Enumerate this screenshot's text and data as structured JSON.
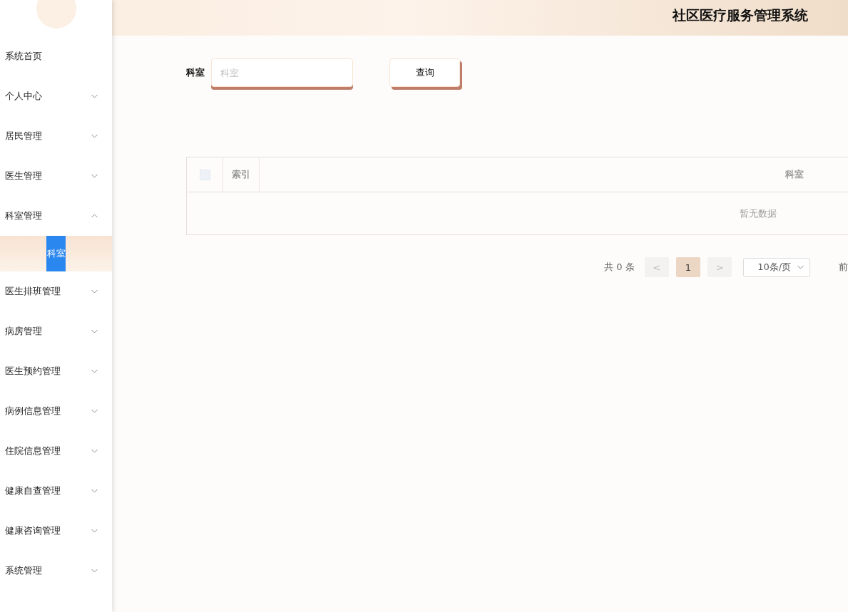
{
  "header": {
    "title": "社区医疗服务管理系统"
  },
  "sidebar": {
    "items": [
      {
        "label": "系统首页",
        "kind": "link"
      },
      {
        "label": "个人中心",
        "kind": "group",
        "expanded": false
      },
      {
        "label": "居民管理",
        "kind": "group",
        "expanded": false
      },
      {
        "label": "医生管理",
        "kind": "group",
        "expanded": false
      },
      {
        "label": "科室管理",
        "kind": "group",
        "expanded": true,
        "children": [
          {
            "label": "科室",
            "selected": true
          }
        ]
      },
      {
        "label": "医生排班管理",
        "kind": "group",
        "expanded": false
      },
      {
        "label": "病房管理",
        "kind": "group",
        "expanded": false
      },
      {
        "label": "医生预约管理",
        "kind": "group",
        "expanded": false
      },
      {
        "label": "病例信息管理",
        "kind": "group",
        "expanded": false
      },
      {
        "label": "住院信息管理",
        "kind": "group",
        "expanded": false
      },
      {
        "label": "健康自查管理",
        "kind": "group",
        "expanded": false
      },
      {
        "label": "健康咨询管理",
        "kind": "group",
        "expanded": false
      },
      {
        "label": "系统管理",
        "kind": "group",
        "expanded": false
      }
    ]
  },
  "search": {
    "label": "科室",
    "placeholder": "科室",
    "button": "查询"
  },
  "table": {
    "select_all": {
      "checked": false
    },
    "columns": [
      "索引",
      "科室"
    ],
    "empty_text": "暂无数据"
  },
  "pagination": {
    "total": "共 0 条",
    "prev": "<",
    "pages": [
      {
        "label": "1",
        "selected": true
      }
    ],
    "next": ">",
    "page_size": "10条/页",
    "jump_label": "前"
  }
}
